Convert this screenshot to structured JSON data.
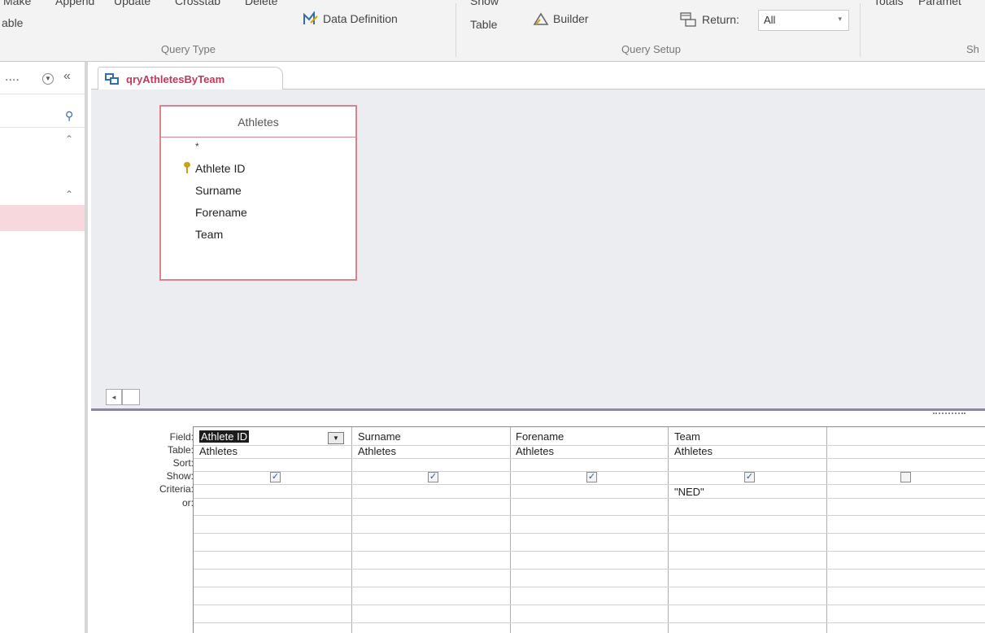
{
  "ribbon": {
    "query_type_buttons": [
      "Make",
      "Append",
      "Update",
      "Crosstab",
      "Delete"
    ],
    "make_table_suffix": "able",
    "data_definition_label": "Data Definition",
    "show_table_top": "Show",
    "show_table_label": "Table",
    "builder_label": "Builder",
    "return_label": "Return:",
    "return_value": "All",
    "totals_label": "Totals",
    "parameters_label": "Paramet",
    "query_type_group": "Query Type",
    "query_setup_group": "Query Setup",
    "show_hide_group": "Sh"
  },
  "nav": {
    "ellipsis": "....",
    "search_icon": "search-icon"
  },
  "tab": {
    "label": "qryAthletesByTeam"
  },
  "table_box": {
    "title": "Athletes",
    "star": "*",
    "fields": [
      "Athlete ID",
      "Surname",
      "Forename",
      "Team"
    ]
  },
  "grid": {
    "row_labels": [
      "Field:",
      "Table:",
      "Sort:",
      "Show:",
      "Criteria:",
      "or:"
    ],
    "columns": [
      {
        "field": "Athlete ID",
        "table": "Athletes",
        "show": true,
        "criteria": ""
      },
      {
        "field": "Surname",
        "table": "Athletes",
        "show": true,
        "criteria": ""
      },
      {
        "field": "Forename",
        "table": "Athletes",
        "show": true,
        "criteria": ""
      },
      {
        "field": "Team",
        "table": "Athletes",
        "show": true,
        "criteria": "\"NED\""
      },
      {
        "field": "",
        "table": "",
        "show": false,
        "criteria": ""
      }
    ]
  },
  "colors": {
    "accent": "#c0395a",
    "table_border": "#d8838e",
    "design_bg": "#ebedf0",
    "ribbon_bg": "#f3f3f3",
    "nav_selected": "#f7d8dd"
  }
}
